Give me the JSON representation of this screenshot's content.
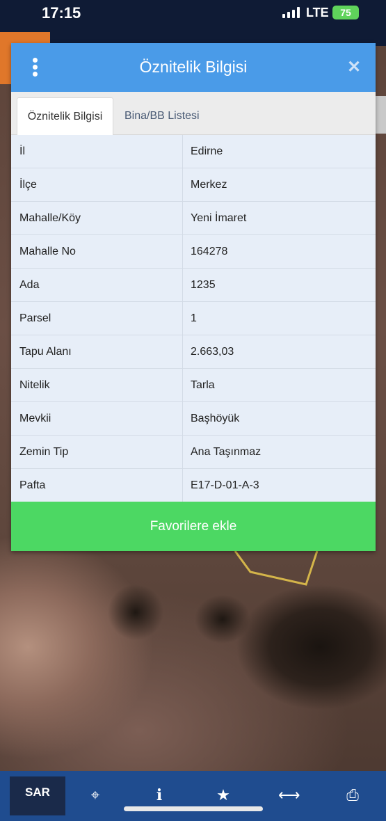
{
  "status_bar": {
    "time": "17:15",
    "network": "LTE",
    "battery": "75"
  },
  "dialog": {
    "title": "Öznitelik Bilgisi",
    "tabs": [
      {
        "label": "Öznitelik Bilgisi",
        "active": true
      },
      {
        "label": "Bina/BB Listesi",
        "active": false
      }
    ],
    "rows": [
      {
        "key": "İl",
        "value": "Edirne"
      },
      {
        "key": "İlçe",
        "value": "Merkez"
      },
      {
        "key": "Mahalle/Köy",
        "value": "Yeni İmaret"
      },
      {
        "key": "Mahalle No",
        "value": "164278"
      },
      {
        "key": "Ada",
        "value": "1235"
      },
      {
        "key": "Parsel",
        "value": "1"
      },
      {
        "key": "Tapu Alanı",
        "value": "2.663,03"
      },
      {
        "key": "Nitelik",
        "value": "Tarla"
      },
      {
        "key": "Mevkii",
        "value": "Başhöyük"
      },
      {
        "key": "Zemin Tip",
        "value": "Ana Taşınmaz"
      },
      {
        "key": "Pafta",
        "value": "E17-D-01-A-3"
      }
    ],
    "favorite_button": "Favorilere ekle"
  },
  "bottom_bar": {
    "logo": "SAR",
    "icons": [
      "crosshair-icon",
      "info-icon",
      "star-icon",
      "arrows-horizontal-icon",
      "print-icon"
    ]
  },
  "colors": {
    "header": "#4a9be8",
    "favorite_button": "#4cd863",
    "bottom_bar": "#1f4c8f",
    "parcel_outline": "#d4b54a"
  }
}
